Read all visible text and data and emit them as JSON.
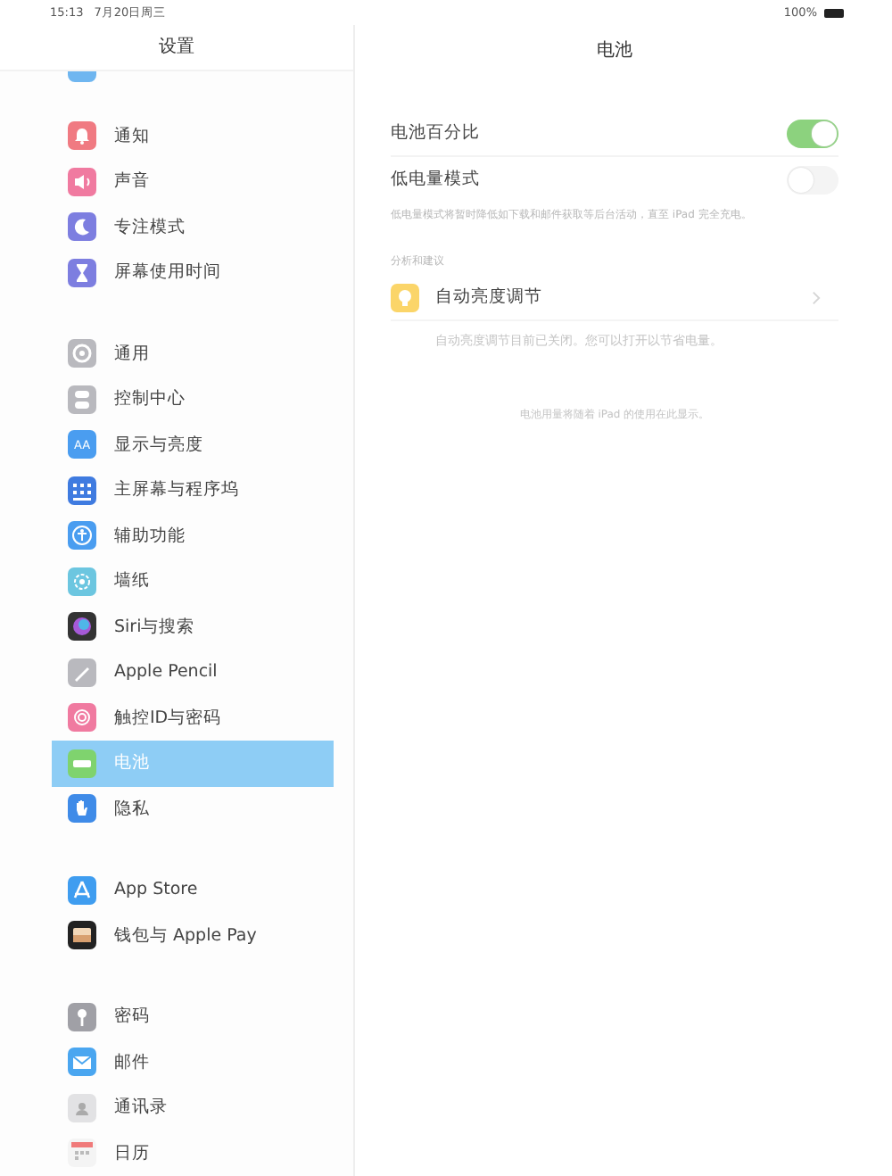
{
  "status_bar": {
    "time": "15:13",
    "date": "7月20日周三",
    "battery": "100%"
  },
  "sidebar": {
    "title": "设置",
    "groups": [
      {
        "items": [
          {
            "label": "通知",
            "selected": false
          },
          {
            "label": "声音",
            "selected": false
          },
          {
            "label": "专注模式",
            "selected": false
          },
          {
            "label": "屏幕使用时间",
            "selected": false
          }
        ]
      },
      {
        "items": [
          {
            "label": "通用",
            "selected": false
          },
          {
            "label": "控制中心",
            "selected": false
          },
          {
            "label": "显示与亮度",
            "icon_text": "AA",
            "selected": false
          },
          {
            "label": "主屏幕与程序坞",
            "selected": false
          },
          {
            "label": "辅助功能",
            "selected": false
          },
          {
            "label": "墙纸",
            "selected": false
          },
          {
            "label": "Siri与搜索",
            "selected": false
          },
          {
            "label": "Apple Pencil",
            "selected": false
          },
          {
            "label": "触控ID与密码",
            "selected": false
          },
          {
            "label": "电池",
            "selected": true
          },
          {
            "label": "隐私",
            "selected": false
          }
        ]
      },
      {
        "items": [
          {
            "label": "App Store",
            "selected": false
          },
          {
            "label": "钱包与 Apple Pay",
            "selected": false
          }
        ]
      },
      {
        "items": [
          {
            "label": "密码",
            "selected": false
          },
          {
            "label": "邮件",
            "selected": false
          },
          {
            "label": "通讯录",
            "selected": false
          },
          {
            "label": "日历",
            "selected": false
          }
        ]
      }
    ]
  },
  "detail": {
    "title": "电池",
    "toggles": [
      {
        "label": "电池百分比",
        "on": true
      },
      {
        "label": "低电量模式",
        "on": false
      }
    ],
    "toggle_note": "低电量模式将暂时降低如下载和邮件获取等后台活动，直至 iPad 完全充电。",
    "section_header": "分析和建议",
    "suggestion": {
      "label": "自动亮度调节",
      "note": "自动亮度调节目前已关闭。您可以打开以节省电量。"
    },
    "footer": "电池用量将随着 iPad 的使用在此显示。"
  }
}
